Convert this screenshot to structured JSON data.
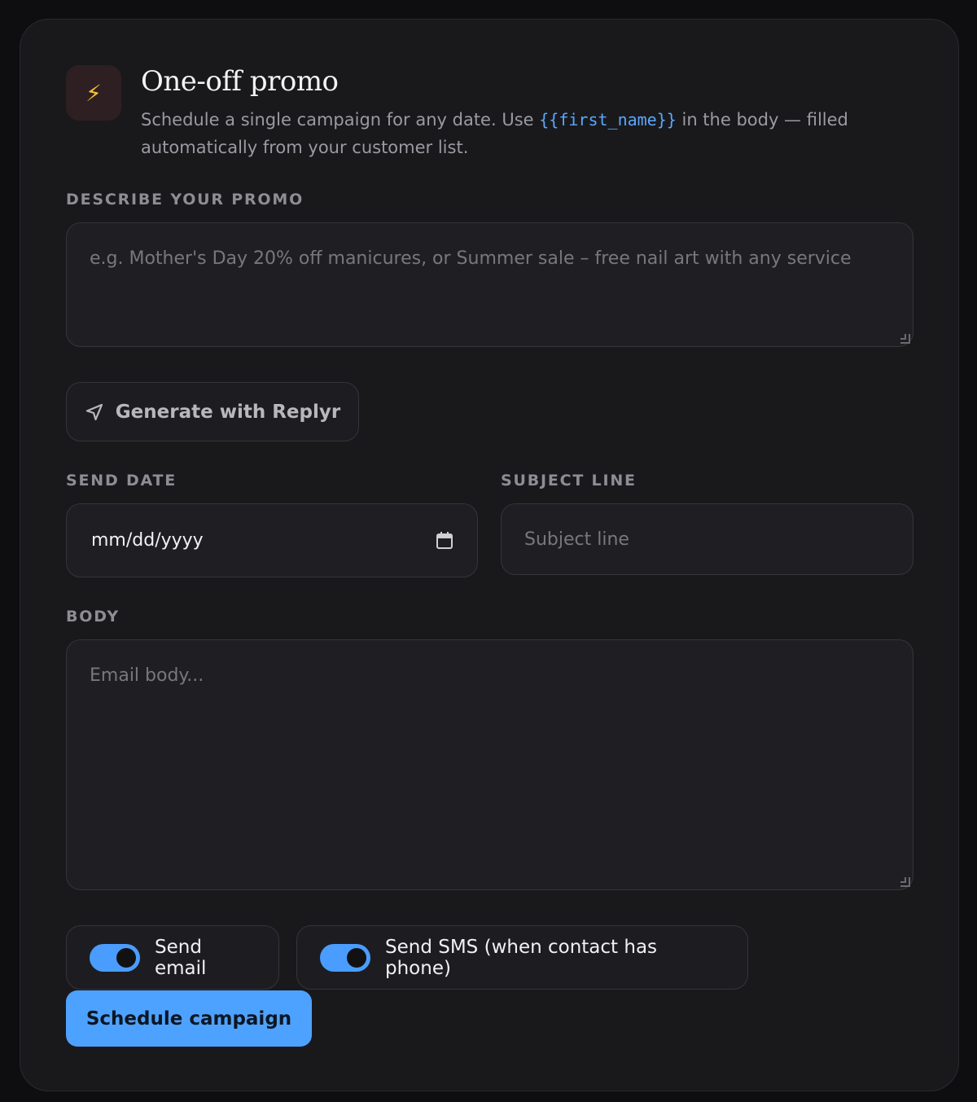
{
  "header": {
    "icon": "lightning-bolt-icon",
    "title": "One-off promo",
    "description_before": "Schedule a single campaign for any date. Use ",
    "description_token": "{{first_name}}",
    "description_after": " in the body — filled automatically from your customer list."
  },
  "promo": {
    "label": "Describe your promo",
    "placeholder": "e.g. Mother's Day 20% off manicures, or Summer sale – free nail art with any service"
  },
  "generate_button": {
    "icon": "send-arrow-icon",
    "label": "Generate with Replyr"
  },
  "send_date": {
    "label": "Send date",
    "value": "mm/dd/yyyy",
    "icon": "calendar-icon"
  },
  "subject": {
    "label": "Subject line",
    "placeholder": "Subject line"
  },
  "body": {
    "label": "Body",
    "placeholder": "Email body..."
  },
  "toggles": {
    "email": {
      "label": "Send email",
      "on": true
    },
    "sms": {
      "label": "Send SMS (when contact has phone)",
      "on": true
    }
  },
  "submit": {
    "label": "Schedule campaign"
  },
  "colors": {
    "accent": "#4ea2ff",
    "token": "#5aa7ff",
    "icon_bolt": "#f4c13a"
  }
}
